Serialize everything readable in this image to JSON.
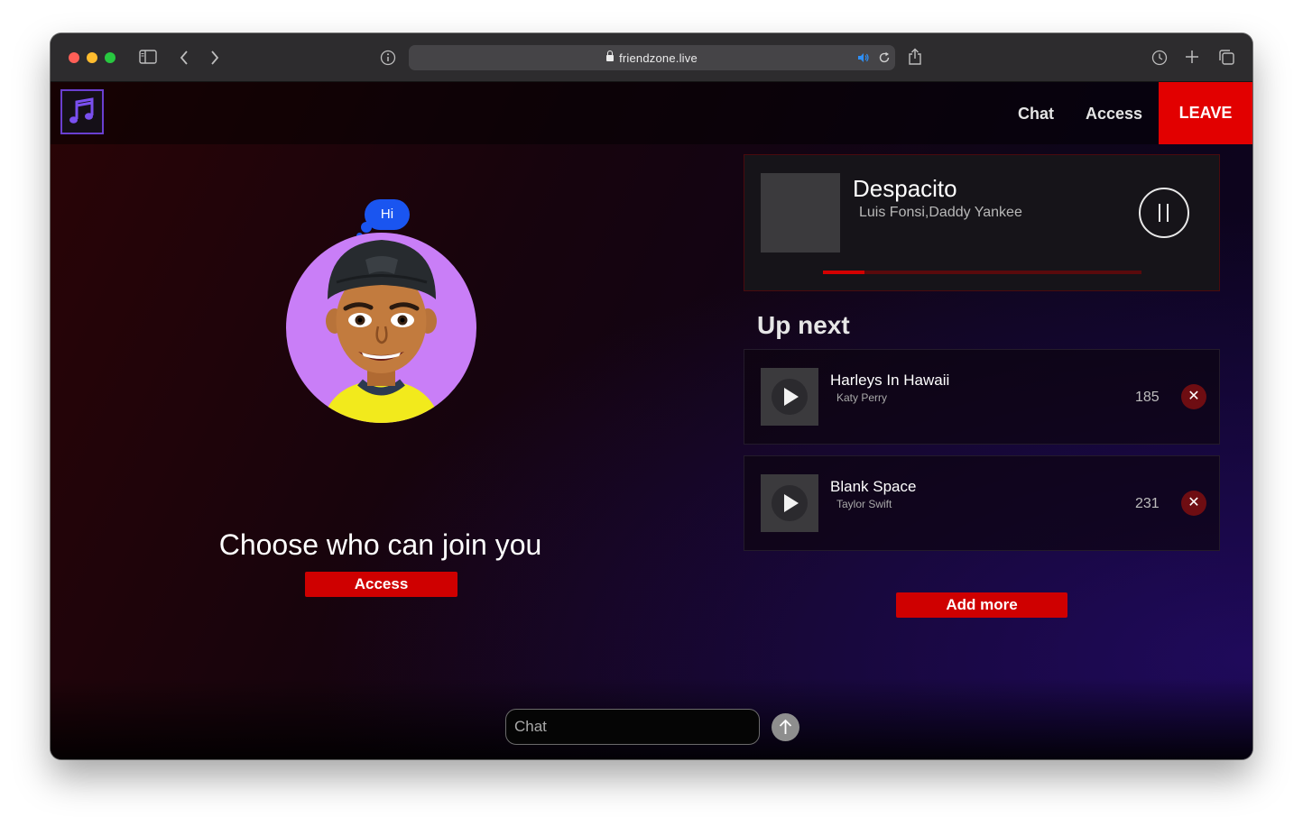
{
  "browser": {
    "url": "friendzone.live"
  },
  "nav": {
    "chat": "Chat",
    "access": "Access",
    "leave": "LEAVE"
  },
  "room": {
    "speech_bubble": "Hi",
    "choose_text": "Choose who can join you",
    "access_button": "Access"
  },
  "now_playing": {
    "title": "Despacito",
    "artist": "Luis Fonsi,Daddy Yankee",
    "progress": 0.13
  },
  "up_next": {
    "heading": "Up next",
    "items": [
      {
        "title": "Harleys In Hawaii",
        "artist": "Katy Perry",
        "votes": "185"
      },
      {
        "title": "Blank Space",
        "artist": "Taylor Swift",
        "votes": "231"
      }
    ],
    "add_more": "Add more"
  },
  "chat": {
    "placeholder": "Chat"
  },
  "icons": {
    "remove": "✕"
  },
  "colors": {
    "accent_red": "#e20000",
    "bubble_blue": "#1a55f0",
    "avatar_bg": "#c97ef7",
    "logo_border": "#6a3fd0"
  }
}
